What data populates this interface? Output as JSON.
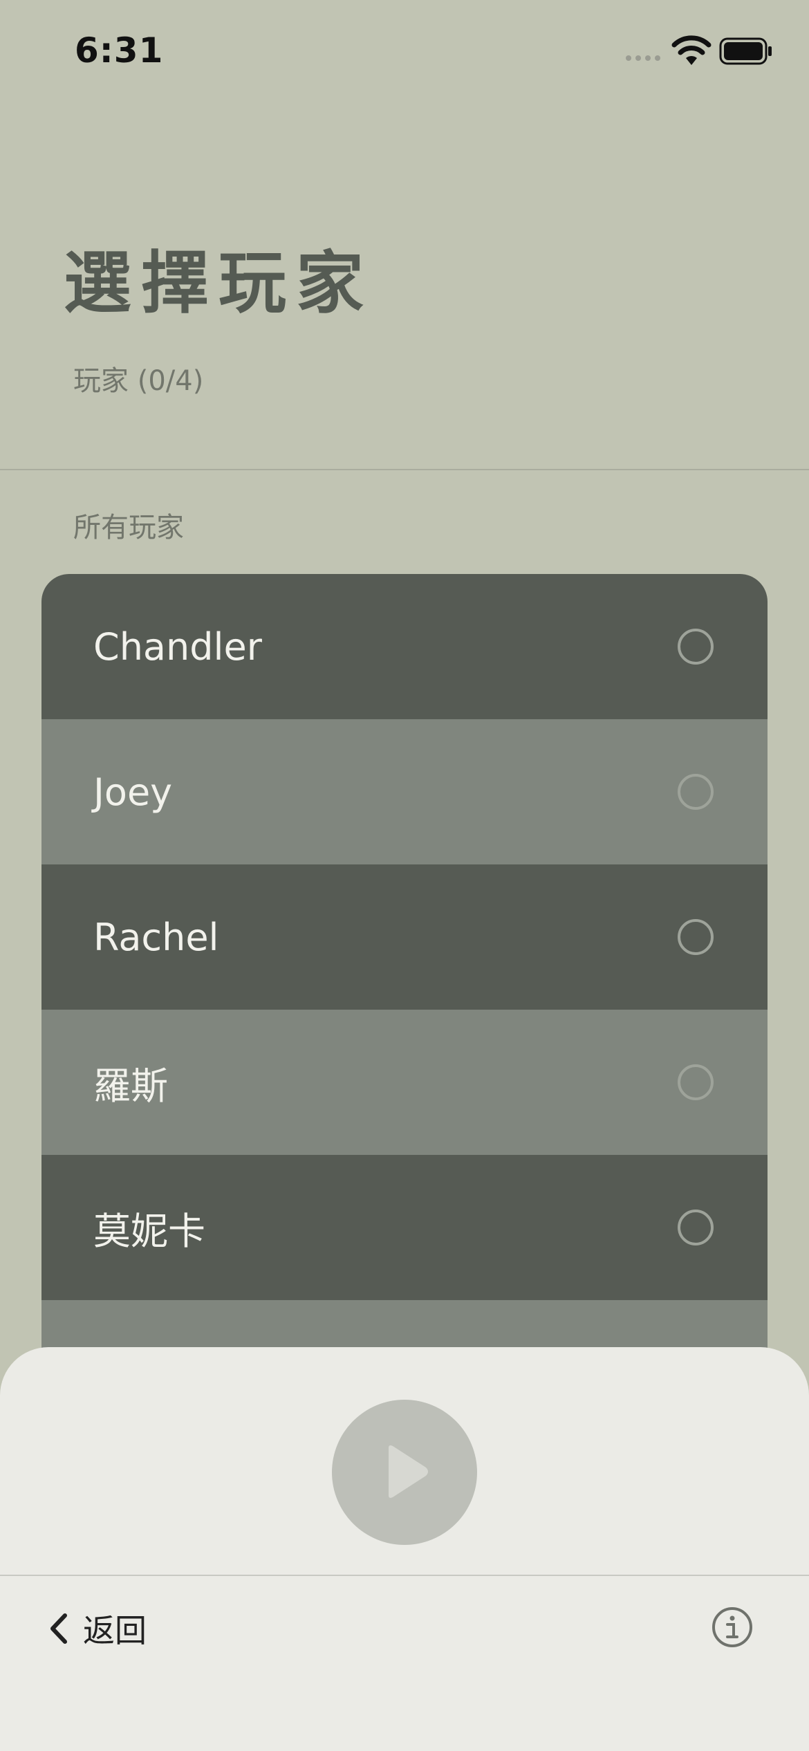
{
  "status_bar": {
    "time": "6:31"
  },
  "header": {
    "title": "選擇玩家",
    "player_count": "玩家 (0/4)"
  },
  "section_label": "所有玩家",
  "players": [
    {
      "name": "Chandler"
    },
    {
      "name": "Joey"
    },
    {
      "name": "Rachel"
    },
    {
      "name": "羅斯"
    },
    {
      "name": "莫妮卡"
    },
    {
      "name": ""
    }
  ],
  "footer": {
    "back_label": "返回"
  },
  "icons": {
    "play": "play-icon",
    "back": "chevron-left-icon",
    "info": "info-icon"
  },
  "colors": {
    "background": "#c1c4b3",
    "row_dark": "#565b54",
    "row_light": "#80867e",
    "sheet": "#ebebe6"
  }
}
